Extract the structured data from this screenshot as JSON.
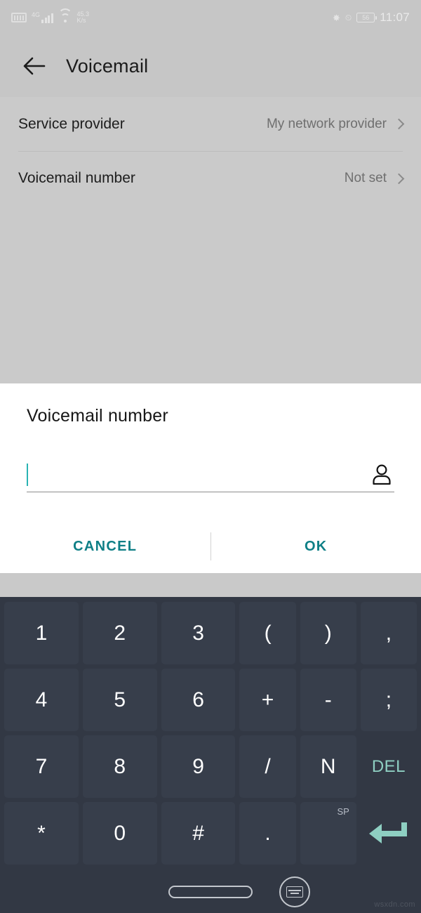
{
  "status_bar": {
    "sim_icon": "sim-card-icon",
    "network_type": "4G",
    "signal_icon": "signal-bars-icon",
    "wifi_icon": "wifi-icon",
    "network_speed": "45.3",
    "network_speed_unit": "K/s",
    "bluetooth_icon": "bluetooth-icon",
    "alarm_icon": "alarm-icon",
    "battery_level": "56",
    "time": "11:07"
  },
  "app_bar": {
    "back_icon": "back-arrow-icon",
    "title": "Voicemail"
  },
  "settings": {
    "rows": [
      {
        "label": "Service provider",
        "value": "My network provider",
        "chevron": "chevron-right-icon"
      },
      {
        "label": "Voicemail number",
        "value": "Not set",
        "chevron": "chevron-right-icon"
      }
    ]
  },
  "dialog": {
    "title": "Voicemail number",
    "input_value": "",
    "input_placeholder": "",
    "contact_icon": "contact-person-icon",
    "cancel_label": "CANCEL",
    "ok_label": "OK",
    "accent_color": "#0e7f86",
    "caret_color": "#2ab3b3"
  },
  "keyboard": {
    "accent_color": "#8ecfc2",
    "key_bg": "#373e4b",
    "background": "#323844",
    "rows": [
      [
        {
          "label": "1",
          "name": "key-1",
          "type": "num"
        },
        {
          "label": "2",
          "name": "key-2",
          "type": "num"
        },
        {
          "label": "3",
          "name": "key-3",
          "type": "num"
        },
        {
          "label": "(",
          "name": "key-left-paren",
          "type": "sym"
        },
        {
          "label": ")",
          "name": "key-right-paren",
          "type": "sym"
        },
        {
          "label": ",",
          "name": "key-comma",
          "type": "sym"
        }
      ],
      [
        {
          "label": "4",
          "name": "key-4",
          "type": "num"
        },
        {
          "label": "5",
          "name": "key-5",
          "type": "num"
        },
        {
          "label": "6",
          "name": "key-6",
          "type": "num"
        },
        {
          "label": "+",
          "name": "key-plus",
          "type": "sym"
        },
        {
          "label": "-",
          "name": "key-minus",
          "type": "sym"
        },
        {
          "label": ";",
          "name": "key-semicolon",
          "type": "sym"
        }
      ],
      [
        {
          "label": "7",
          "name": "key-7",
          "type": "num"
        },
        {
          "label": "8",
          "name": "key-8",
          "type": "num"
        },
        {
          "label": "9",
          "name": "key-9",
          "type": "num"
        },
        {
          "label": "/",
          "name": "key-slash",
          "type": "sym"
        },
        {
          "label": "N",
          "name": "key-n",
          "type": "sym"
        },
        {
          "label": "DEL",
          "name": "key-delete",
          "type": "del"
        }
      ],
      [
        {
          "label": "*",
          "name": "key-asterisk",
          "type": "num"
        },
        {
          "label": "0",
          "name": "key-0",
          "type": "num"
        },
        {
          "label": "#",
          "name": "key-hash",
          "type": "num"
        },
        {
          "label": ".",
          "name": "key-period",
          "type": "sym"
        },
        {
          "label": "",
          "sub": "SP",
          "name": "key-space",
          "type": "sym"
        },
        {
          "label": "",
          "name": "key-enter",
          "type": "enter"
        }
      ]
    ]
  },
  "nav_bar": {
    "home_icon": "home-pill-icon",
    "keyboard_toggle_icon": "keyboard-toggle-icon"
  },
  "watermark": "wsxdn.com"
}
